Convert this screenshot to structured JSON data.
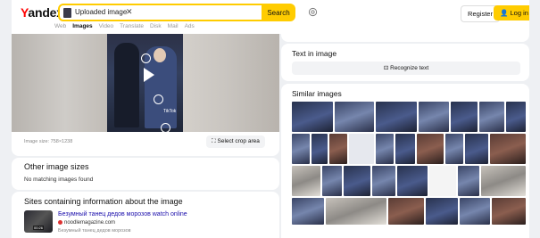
{
  "header": {
    "logo": "Yandex",
    "search_query": "Uploaded image",
    "search_button": "Search",
    "register": "Register",
    "login": "Log in"
  },
  "nav": [
    "Web",
    "Images",
    "Video",
    "Translate",
    "Disk",
    "Mail",
    "Ads"
  ],
  "nav_active": "Images",
  "preview": {
    "image_size": "Image size: 758×1238",
    "select_crop": "Select crop area",
    "watermark": "TikTok"
  },
  "other_sizes": {
    "title": "Other image sizes",
    "message": "No matching images found"
  },
  "sites": {
    "title": "Sites containing information about the image",
    "result_title": "Безумный танец дедов морозов watch online",
    "result_domain": "noodlemagazine.com",
    "result_desc": "Безумный танец дедов морозов",
    "duration": "00:26"
  },
  "text_in_image": {
    "title": "Text in image",
    "button": "Recognize text"
  },
  "similar": {
    "title": "Similar images"
  },
  "colors": {
    "accent": "#ffcc00",
    "logo_red": "#ff0000",
    "link": "#1a0dab",
    "background": "#eef0f3"
  }
}
